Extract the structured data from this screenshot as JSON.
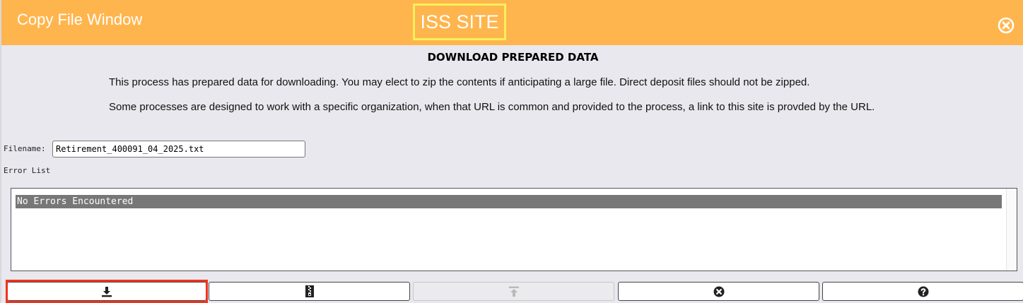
{
  "window": {
    "title": "Copy File Window",
    "site_badge": "ISS SITE"
  },
  "content": {
    "heading": "DOWNLOAD PREPARED DATA",
    "paragraph_1": "This process has prepared data for downloading. You may elect to zip the contents if anticipating a large file. Direct deposit files should not be zipped.",
    "paragraph_2": "Some processes are designed to work with a specific organization, when that URL is common and provided to the process, a link to this site is provded by the URL."
  },
  "filename": {
    "label": "Filename:",
    "value": "Retirement_400091_04_2025.txt"
  },
  "errors": {
    "label": "Error List",
    "items": [
      "No Errors Encountered"
    ]
  },
  "toolbar": {
    "buttons": [
      {
        "icon": "download-icon",
        "enabled": true
      },
      {
        "icon": "zip-file-icon",
        "enabled": true
      },
      {
        "icon": "upload-icon",
        "enabled": false
      },
      {
        "icon": "cancel-icon",
        "enabled": true
      },
      {
        "icon": "help-icon",
        "enabled": true
      }
    ]
  },
  "colors": {
    "titlebar": "#ffb54d",
    "badge_border": "#f5f05a",
    "highlight": "#f2321e",
    "selected_row": "#777777",
    "background": "#e9e8ee"
  }
}
